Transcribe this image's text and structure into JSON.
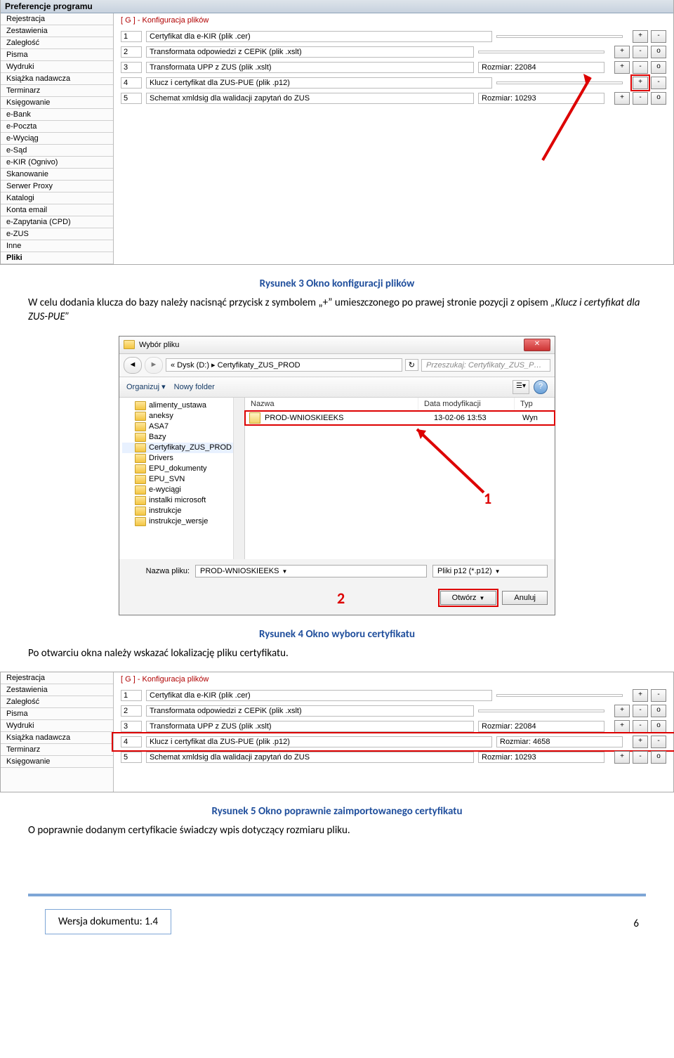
{
  "prefs_window": {
    "title": "Preferencje programu",
    "sidebar": [
      "Rejestracja",
      "Zestawienia",
      "Zaległość",
      "Pisma",
      "Wydruki",
      "Książka nadawcza",
      "Terminarz",
      "Księgowanie",
      "e-Bank",
      "e-Poczta",
      "e-Wyciąg",
      "e-Sąd",
      "e-KIR (Ognivo)",
      "Skanowanie",
      "Serwer Proxy",
      "Katalogi",
      "Konta email",
      "e-Zapytania (CPD)",
      "e-ZUS",
      "Inne",
      "Pliki"
    ],
    "section_label": "[ G ] - Konfiguracja plików",
    "rows": [
      {
        "n": "1",
        "desc": "Certyfikat dla e-KIR (plik .cer)",
        "size": "",
        "btns": [
          "+",
          "-"
        ]
      },
      {
        "n": "2",
        "desc": "Transformata odpowiedzi z CEPiK (plik .xslt)",
        "size": "",
        "btns": [
          "+",
          "-",
          "o"
        ]
      },
      {
        "n": "3",
        "desc": "Transformata UPP z ZUS (plik .xslt)",
        "size": "Rozmiar: 22084",
        "btns": [
          "+",
          "-",
          "o"
        ]
      },
      {
        "n": "4",
        "desc": "Klucz i certyfikat dla ZUS-PUE (plik .p12)",
        "size": "",
        "btns": [
          "+",
          "-"
        ],
        "hl_plus": true
      },
      {
        "n": "5",
        "desc": "Schemat xmldsig dla walidacji zapytań do ZUS",
        "size": "Rozmiar: 10293",
        "btns": [
          "+",
          "-",
          "o"
        ]
      }
    ]
  },
  "caption1": "Rysunek 3  Okno konfiguracji plików",
  "para1a": "W celu dodania klucza do bazy należy nacisnąć przycisk z symbolem „+” umieszczonego po prawej stronie pozycji z opisem ",
  "para1b_italic": "„Klucz i certyfikat dla ZUS-PUE”",
  "file_dialog": {
    "title": "Wybór pliku",
    "breadcrumb": "«  Dysk (D:)  ▸  Certyfikaty_ZUS_PROD",
    "search_placeholder": "Przeszukaj: Certyfikaty_ZUS_P…",
    "organize": "Organizuj ▾",
    "new_folder": "Nowy folder",
    "tree": [
      "alimenty_ustawa",
      "aneksy",
      "ASA7",
      "Bazy",
      "Certyfikaty_ZUS_PROD",
      "Drivers",
      "EPU_dokumenty",
      "EPU_SVN",
      "e-wyciągi",
      "instalki microsoft",
      "instrukcje",
      "instrukcje_wersje"
    ],
    "tree_selected": "Certyfikaty_ZUS_PROD",
    "headers": {
      "name": "Nazwa",
      "date": "Data modyfikacji",
      "type": "Typ"
    },
    "file_row": {
      "name": "PROD-WNIOSKIEEKS",
      "date": "13-02-06 13:53",
      "type": "Wyn"
    },
    "filename_label": "Nazwa pliku:",
    "filename_value": "PROD-WNIOSKIEEKS",
    "filetype": "Pliki p12 (*.p12)",
    "open": "Otwórz",
    "cancel": "Anuluj",
    "annot1": "1",
    "annot2": "2"
  },
  "caption2": "Rysunek 4 Okno wyboru certyfikatu",
  "para2": "Po otwarciu okna należy wskazać lokalizację pliku certyfikatu.",
  "prefs2": {
    "sidebar": [
      "Rejestracja",
      "Zestawienia",
      "Zaległość",
      "Pisma",
      "Wydruki",
      "Książka nadawcza",
      "Terminarz",
      "Księgowanie"
    ],
    "section_label": "[ G ] - Konfiguracja plików",
    "rows": [
      {
        "n": "1",
        "desc": "Certyfikat dla e-KIR (plik .cer)",
        "size": "",
        "btns": [
          "+",
          "-"
        ]
      },
      {
        "n": "2",
        "desc": "Transformata odpowiedzi z CEPiK (plik .xslt)",
        "size": "",
        "btns": [
          "+",
          "-",
          "o"
        ]
      },
      {
        "n": "3",
        "desc": "Transformata UPP z ZUS (plik .xslt)",
        "size": "Rozmiar: 22084",
        "btns": [
          "+",
          "-",
          "o"
        ]
      },
      {
        "n": "4",
        "desc": "Klucz i certyfikat dla ZUS-PUE (plik .p12)",
        "size": "Rozmiar: 4658",
        "btns": [
          "+",
          "-"
        ],
        "hl_row": true
      },
      {
        "n": "5",
        "desc": "Schemat xmldsig dla walidacji zapytań do ZUS",
        "size": "Rozmiar: 10293",
        "btns": [
          "+",
          "-",
          "o"
        ]
      }
    ]
  },
  "caption3": "Rysunek 5 Okno poprawnie zaimportowanego certyfikatu",
  "para3": "O poprawnie dodanym certyfikacie świadczy wpis dotyczący rozmiaru pliku.",
  "version": "Wersja dokumentu: 1.4",
  "pagenum": "6"
}
